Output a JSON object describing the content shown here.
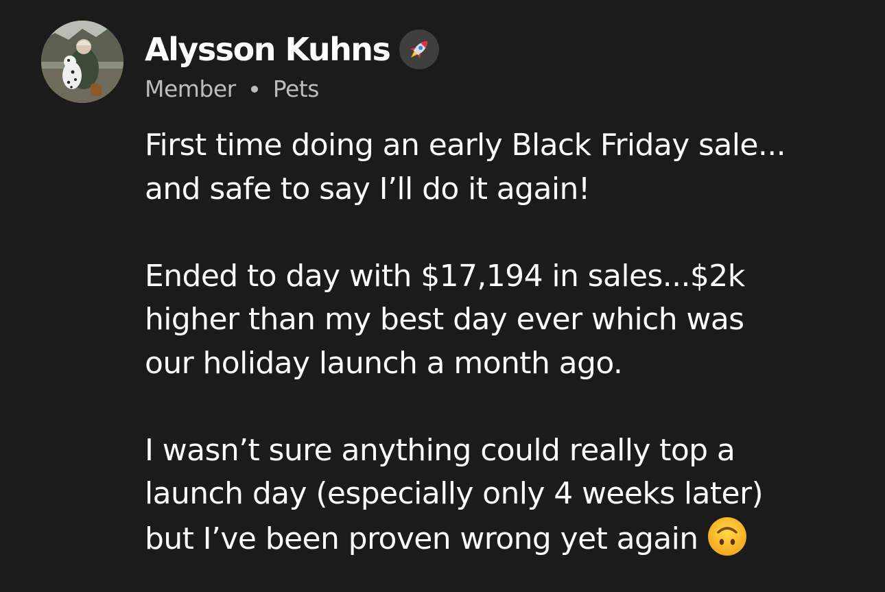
{
  "post": {
    "author": {
      "name": "Alysson Kuhns",
      "badge_icon": "rocket-icon",
      "role": "Member",
      "community": "Pets",
      "avatar_icon": "profile-photo-dog"
    },
    "body": {
      "paragraphs": [
        [
          "First time doing an early Black Friday sale...",
          "and safe to say I’ll do it again!"
        ],
        [
          "Ended to day with $17,194 in sales...$2k",
          "higher than my best day ever which was",
          "our holiday launch a month ago."
        ],
        [
          "I wasn’t sure anything could really top a",
          "launch day (especially only 4 weeks later)",
          "but I’ve been proven wrong yet again"
        ]
      ],
      "trailing_emoji": "upside-down-face-emoji"
    }
  },
  "colors": {
    "background": "#1b1b1b",
    "text": "#ffffff",
    "meta_text": "#bdbdbd",
    "badge_bg": "#3f3f40"
  }
}
